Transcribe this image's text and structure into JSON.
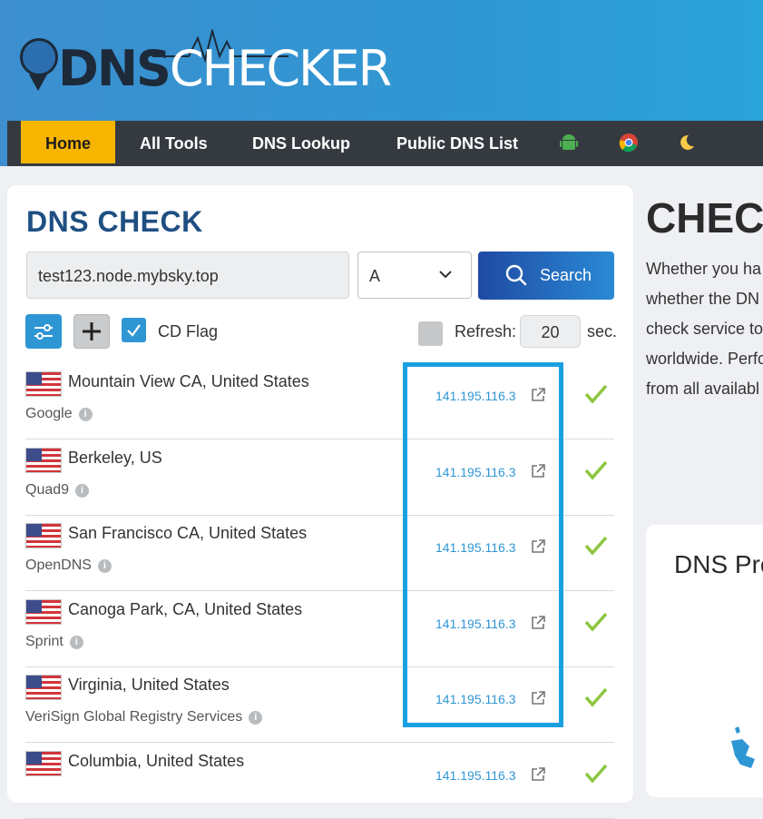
{
  "brand": {
    "part1": "DNS",
    "part2": "CHECKER"
  },
  "nav": {
    "items": [
      {
        "label": "Home",
        "active": true
      },
      {
        "label": "All Tools"
      },
      {
        "label": "DNS Lookup"
      },
      {
        "label": "Public DNS List"
      }
    ],
    "icons": [
      "android-icon",
      "chrome-icon",
      "moon-icon"
    ]
  },
  "dns_check": {
    "title": "DNS CHECK",
    "domain_value": "test123.node.mybsky.top",
    "record_type": "A",
    "search_label": "Search",
    "cd_flag_label": "CD Flag",
    "refresh_label": "Refresh:",
    "refresh_value": "20",
    "sec_label": "sec."
  },
  "results": [
    {
      "location": "Mountain View CA, United States",
      "provider": "Google",
      "ip": "141.195.116.3"
    },
    {
      "location": "Berkeley, US",
      "provider": "Quad9",
      "ip": "141.195.116.3"
    },
    {
      "location": "San Francisco CA, United States",
      "provider": "OpenDNS",
      "ip": "141.195.116.3"
    },
    {
      "location": "Canoga Park, CA, United States",
      "provider": "Sprint",
      "ip": "141.195.116.3"
    },
    {
      "location": "Virginia, United States",
      "provider": "VeriSign Global Registry Services",
      "ip": "141.195.116.3"
    },
    {
      "location": "Columbia, United States",
      "provider": "",
      "ip": "141.195.116.3"
    }
  ],
  "right": {
    "title": "CHECK",
    "lines": [
      "Whether you ha",
      "whether the DN",
      "check service to",
      "worldwide. Perfo",
      "from all availabl"
    ],
    "card_title": "DNS Pro"
  },
  "colors": {
    "accent": "#2f96d4",
    "home": "#f7b500",
    "nav": "#343a40",
    "title": "#1f4f82",
    "check": "#8dc63f"
  }
}
